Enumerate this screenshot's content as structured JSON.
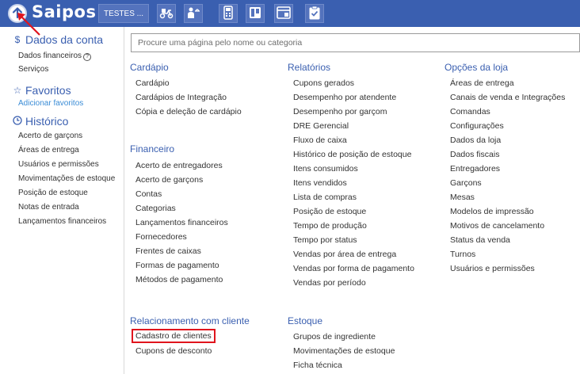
{
  "topbar": {
    "logo": "Saipos",
    "store_label": "TESTES ...",
    "icons": [
      "delivery-scooter-icon",
      "waiter-icon",
      "pos-terminal-icon",
      "kanban-board-icon",
      "screen-icon",
      "clipboard-check-icon"
    ],
    "bg_color": "#3a5fb0"
  },
  "sidebar": {
    "account": {
      "title": "Dados da conta",
      "items": [
        "Dados financeiros",
        "Serviços"
      ]
    },
    "favorites": {
      "title": "Favoritos",
      "add_label": "Adicionar favoritos"
    },
    "history": {
      "title": "Histórico",
      "items": [
        "Acerto de garçons",
        "Áreas de entrega",
        "Usuários e permissões",
        "Movimentações de estoque",
        "Posição de estoque",
        "Notas de entrada",
        "Lançamentos financeiros"
      ]
    }
  },
  "search": {
    "placeholder": "Procure uma página pelo nome ou categoria"
  },
  "menu": {
    "cardapio": {
      "title": "Cardápio",
      "items": [
        "Cardápio",
        "Cardápios de Integração",
        "Cópia e deleção de cardápio"
      ]
    },
    "financeiro": {
      "title": "Financeiro",
      "items": [
        "Acerto de entregadores",
        "Acerto de garçons",
        "Contas",
        "Categorias",
        "Lançamentos financeiros",
        "Fornecedores",
        "Frentes de caixas",
        "Formas de pagamento",
        "Métodos de pagamento"
      ]
    },
    "relacionamento": {
      "title": "Relacionamento com cliente",
      "items": [
        "Cadastro de clientes",
        "Cupons de desconto"
      ]
    },
    "relatorios": {
      "title": "Relatórios",
      "items": [
        "Cupons gerados",
        "Desempenho por atendente",
        "Desempenho por garçom",
        "DRE Gerencial",
        "Fluxo de caixa",
        "Histórico de posição de estoque",
        "Itens consumidos",
        "Itens vendidos",
        "Lista de compras",
        "Posição de estoque",
        "Tempo de produção",
        "Tempo por status",
        "Vendas por área de entrega",
        "Vendas por forma de pagamento",
        "Vendas por período"
      ]
    },
    "estoque": {
      "title": "Estoque",
      "items": [
        "Grupos de ingrediente",
        "Movimentações de estoque",
        "Ficha técnica"
      ]
    },
    "opcoes": {
      "title": "Opções da loja",
      "items": [
        "Áreas de entrega",
        "Canais de venda e Integrações",
        "Comandas",
        "Configurações",
        "Dados da loja",
        "Dados fiscais",
        "Entregadores",
        "Garçons",
        "Mesas",
        "Modelos de impressão",
        "Motivos de cancelamento",
        "Status da venda",
        "Turnos",
        "Usuários e permissões"
      ]
    }
  },
  "colors": {
    "accent": "#3a5fb0",
    "highlight_red": "#e0141d"
  }
}
